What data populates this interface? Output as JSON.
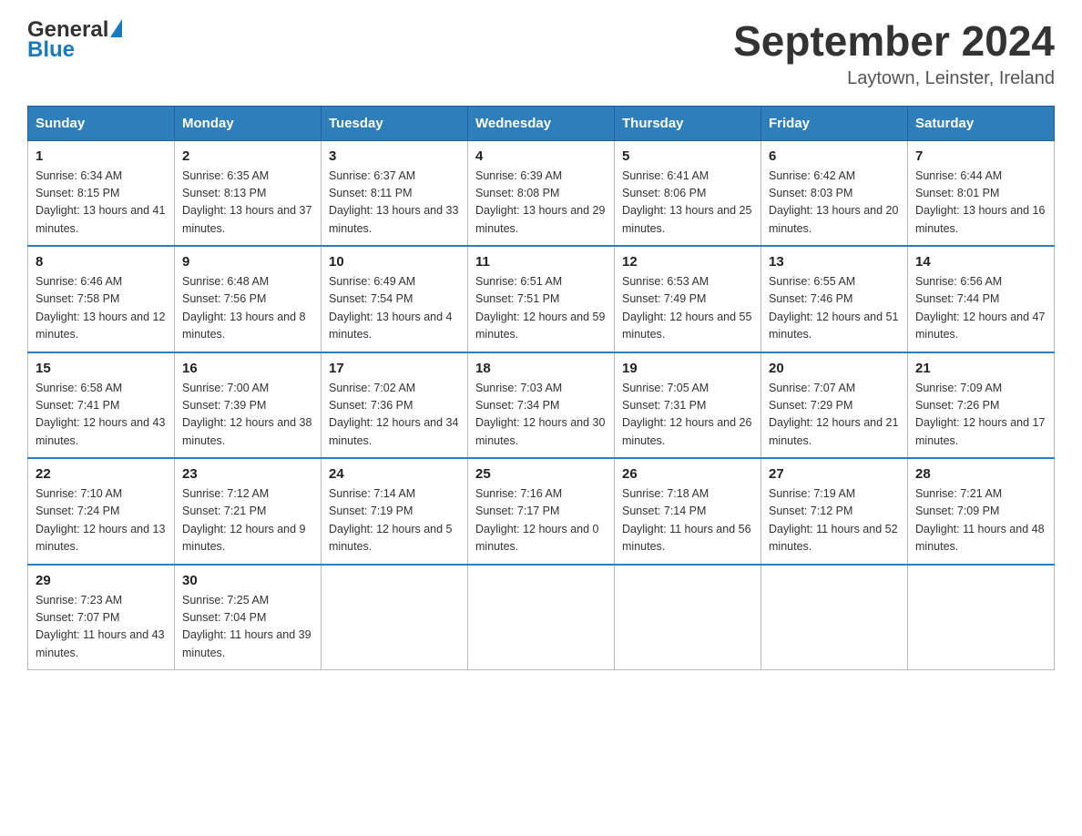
{
  "header": {
    "logo_text_black": "General",
    "logo_text_blue": "Blue",
    "month": "September 2024",
    "location": "Laytown, Leinster, Ireland"
  },
  "weekdays": [
    "Sunday",
    "Monday",
    "Tuesday",
    "Wednesday",
    "Thursday",
    "Friday",
    "Saturday"
  ],
  "weeks": [
    [
      {
        "day": "1",
        "sunrise": "Sunrise: 6:34 AM",
        "sunset": "Sunset: 8:15 PM",
        "daylight": "Daylight: 13 hours and 41 minutes."
      },
      {
        "day": "2",
        "sunrise": "Sunrise: 6:35 AM",
        "sunset": "Sunset: 8:13 PM",
        "daylight": "Daylight: 13 hours and 37 minutes."
      },
      {
        "day": "3",
        "sunrise": "Sunrise: 6:37 AM",
        "sunset": "Sunset: 8:11 PM",
        "daylight": "Daylight: 13 hours and 33 minutes."
      },
      {
        "day": "4",
        "sunrise": "Sunrise: 6:39 AM",
        "sunset": "Sunset: 8:08 PM",
        "daylight": "Daylight: 13 hours and 29 minutes."
      },
      {
        "day": "5",
        "sunrise": "Sunrise: 6:41 AM",
        "sunset": "Sunset: 8:06 PM",
        "daylight": "Daylight: 13 hours and 25 minutes."
      },
      {
        "day": "6",
        "sunrise": "Sunrise: 6:42 AM",
        "sunset": "Sunset: 8:03 PM",
        "daylight": "Daylight: 13 hours and 20 minutes."
      },
      {
        "day": "7",
        "sunrise": "Sunrise: 6:44 AM",
        "sunset": "Sunset: 8:01 PM",
        "daylight": "Daylight: 13 hours and 16 minutes."
      }
    ],
    [
      {
        "day": "8",
        "sunrise": "Sunrise: 6:46 AM",
        "sunset": "Sunset: 7:58 PM",
        "daylight": "Daylight: 13 hours and 12 minutes."
      },
      {
        "day": "9",
        "sunrise": "Sunrise: 6:48 AM",
        "sunset": "Sunset: 7:56 PM",
        "daylight": "Daylight: 13 hours and 8 minutes."
      },
      {
        "day": "10",
        "sunrise": "Sunrise: 6:49 AM",
        "sunset": "Sunset: 7:54 PM",
        "daylight": "Daylight: 13 hours and 4 minutes."
      },
      {
        "day": "11",
        "sunrise": "Sunrise: 6:51 AM",
        "sunset": "Sunset: 7:51 PM",
        "daylight": "Daylight: 12 hours and 59 minutes."
      },
      {
        "day": "12",
        "sunrise": "Sunrise: 6:53 AM",
        "sunset": "Sunset: 7:49 PM",
        "daylight": "Daylight: 12 hours and 55 minutes."
      },
      {
        "day": "13",
        "sunrise": "Sunrise: 6:55 AM",
        "sunset": "Sunset: 7:46 PM",
        "daylight": "Daylight: 12 hours and 51 minutes."
      },
      {
        "day": "14",
        "sunrise": "Sunrise: 6:56 AM",
        "sunset": "Sunset: 7:44 PM",
        "daylight": "Daylight: 12 hours and 47 minutes."
      }
    ],
    [
      {
        "day": "15",
        "sunrise": "Sunrise: 6:58 AM",
        "sunset": "Sunset: 7:41 PM",
        "daylight": "Daylight: 12 hours and 43 minutes."
      },
      {
        "day": "16",
        "sunrise": "Sunrise: 7:00 AM",
        "sunset": "Sunset: 7:39 PM",
        "daylight": "Daylight: 12 hours and 38 minutes."
      },
      {
        "day": "17",
        "sunrise": "Sunrise: 7:02 AM",
        "sunset": "Sunset: 7:36 PM",
        "daylight": "Daylight: 12 hours and 34 minutes."
      },
      {
        "day": "18",
        "sunrise": "Sunrise: 7:03 AM",
        "sunset": "Sunset: 7:34 PM",
        "daylight": "Daylight: 12 hours and 30 minutes."
      },
      {
        "day": "19",
        "sunrise": "Sunrise: 7:05 AM",
        "sunset": "Sunset: 7:31 PM",
        "daylight": "Daylight: 12 hours and 26 minutes."
      },
      {
        "day": "20",
        "sunrise": "Sunrise: 7:07 AM",
        "sunset": "Sunset: 7:29 PM",
        "daylight": "Daylight: 12 hours and 21 minutes."
      },
      {
        "day": "21",
        "sunrise": "Sunrise: 7:09 AM",
        "sunset": "Sunset: 7:26 PM",
        "daylight": "Daylight: 12 hours and 17 minutes."
      }
    ],
    [
      {
        "day": "22",
        "sunrise": "Sunrise: 7:10 AM",
        "sunset": "Sunset: 7:24 PM",
        "daylight": "Daylight: 12 hours and 13 minutes."
      },
      {
        "day": "23",
        "sunrise": "Sunrise: 7:12 AM",
        "sunset": "Sunset: 7:21 PM",
        "daylight": "Daylight: 12 hours and 9 minutes."
      },
      {
        "day": "24",
        "sunrise": "Sunrise: 7:14 AM",
        "sunset": "Sunset: 7:19 PM",
        "daylight": "Daylight: 12 hours and 5 minutes."
      },
      {
        "day": "25",
        "sunrise": "Sunrise: 7:16 AM",
        "sunset": "Sunset: 7:17 PM",
        "daylight": "Daylight: 12 hours and 0 minutes."
      },
      {
        "day": "26",
        "sunrise": "Sunrise: 7:18 AM",
        "sunset": "Sunset: 7:14 PM",
        "daylight": "Daylight: 11 hours and 56 minutes."
      },
      {
        "day": "27",
        "sunrise": "Sunrise: 7:19 AM",
        "sunset": "Sunset: 7:12 PM",
        "daylight": "Daylight: 11 hours and 52 minutes."
      },
      {
        "day": "28",
        "sunrise": "Sunrise: 7:21 AM",
        "sunset": "Sunset: 7:09 PM",
        "daylight": "Daylight: 11 hours and 48 minutes."
      }
    ],
    [
      {
        "day": "29",
        "sunrise": "Sunrise: 7:23 AM",
        "sunset": "Sunset: 7:07 PM",
        "daylight": "Daylight: 11 hours and 43 minutes."
      },
      {
        "day": "30",
        "sunrise": "Sunrise: 7:25 AM",
        "sunset": "Sunset: 7:04 PM",
        "daylight": "Daylight: 11 hours and 39 minutes."
      },
      null,
      null,
      null,
      null,
      null
    ]
  ]
}
